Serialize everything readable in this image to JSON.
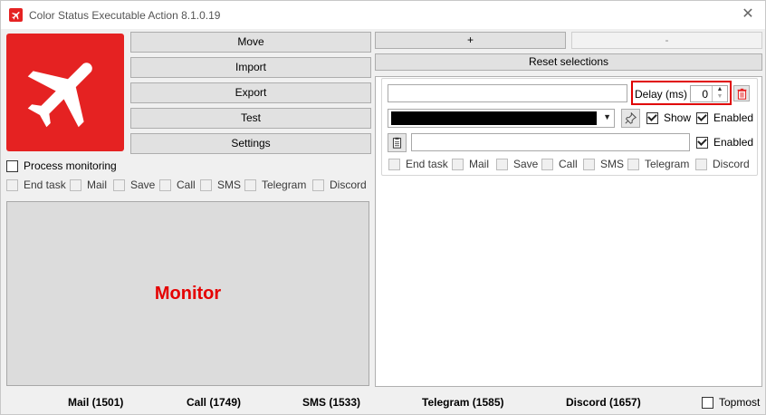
{
  "window": {
    "title": "Color Status Executable Action 8.1.0.19"
  },
  "buttons": {
    "move": "Move",
    "import": "Import",
    "export": "Export",
    "test": "Test",
    "settings": "Settings",
    "plus": "+",
    "minus": "-",
    "reset": "Reset selections"
  },
  "process_monitoring": {
    "label": "Process monitoring",
    "checked": false
  },
  "left_options": [
    "End task",
    "Mail",
    "Save",
    "Call",
    "SMS",
    "Telegram",
    "Discord"
  ],
  "monitor": {
    "label": "Monitor",
    "color": "#e50000"
  },
  "action": {
    "delay_label": "Delay (ms)",
    "delay_value": "0",
    "show_label": "Show",
    "enabled_label": "Enabled",
    "enabled2_label": "Enabled",
    "color_value": "#000000",
    "options": [
      "End task",
      "Mail",
      "Save",
      "Call",
      "SMS",
      "Telegram",
      "Discord"
    ]
  },
  "status": {
    "mail": "Mail (1501)",
    "call": "Call (1749)",
    "sms": "SMS (1533)",
    "telegram": "Telegram (1585)",
    "discord": "Discord (1657)"
  },
  "topmost": {
    "label": "Topmost",
    "checked": false
  },
  "colors": {
    "brand": "#e52222",
    "highlight": "#e00000"
  },
  "icons": [
    "airplane-icon",
    "close-icon",
    "trash-icon",
    "pin-icon",
    "clipboard-icon",
    "chevron-down-icon"
  ]
}
